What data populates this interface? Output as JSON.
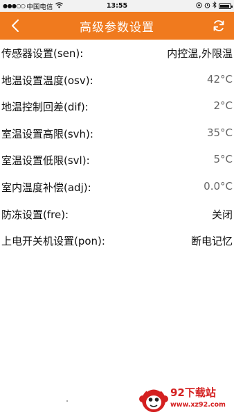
{
  "status_bar": {
    "signal_dots": "●●●○○",
    "carrier": "中国电信",
    "wifi_icon": "wifi-icon",
    "time": "13:55",
    "battery_level": 0.9
  },
  "header": {
    "title": "高级参数设置",
    "back_icon": "chevron-left-icon",
    "refresh_icon": "refresh-icon",
    "background_color": "#f07a1e"
  },
  "settings": [
    {
      "label": "传感器设置(sen):",
      "value": "内控温,外限温"
    },
    {
      "label": "地温设置温度(osv):",
      "value": "42°C"
    },
    {
      "label": "地温控制回差(dif):",
      "value": "2°C"
    },
    {
      "label": "室温设置高限(svh):",
      "value": "35°C"
    },
    {
      "label": "室温设置低限(svl):",
      "value": "5°C"
    },
    {
      "label": "室内温度补偿(adj):",
      "value": "0.0°C"
    },
    {
      "label": "防冻设置(fre):",
      "value": "关闭"
    },
    {
      "label": "上电开关机设置(pon):",
      "value": "断电记忆"
    }
  ],
  "watermark": {
    "title": "92下载站",
    "url": "www.xz92.com"
  }
}
